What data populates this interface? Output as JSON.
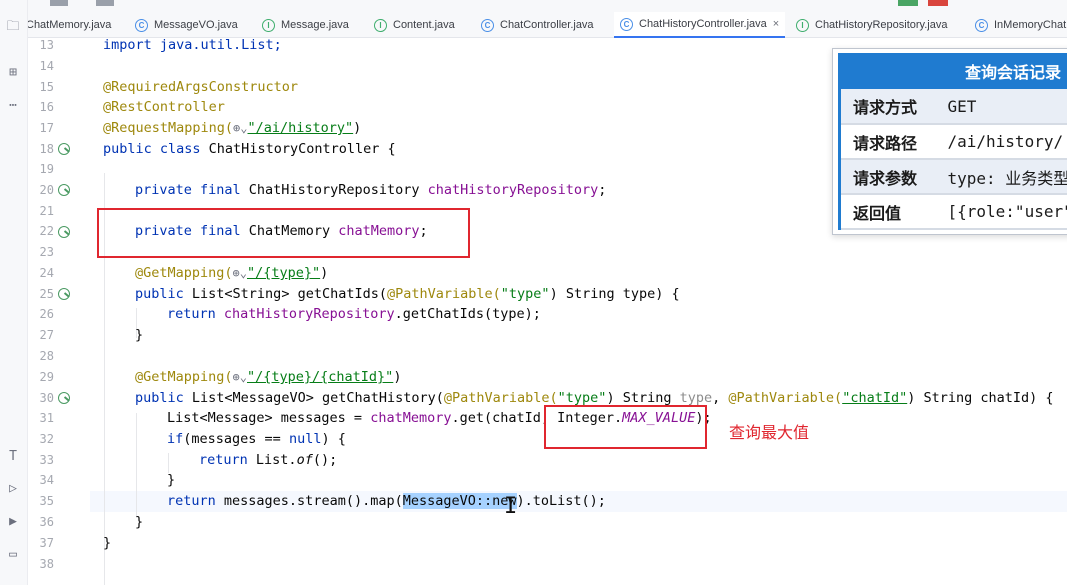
{
  "tabs": [
    {
      "label": "ChatMemory.java",
      "icon": "interface-icon",
      "active": false
    },
    {
      "label": "MessageVO.java",
      "icon": "class-icon",
      "active": false
    },
    {
      "label": "Message.java",
      "icon": "interface-icon",
      "active": false
    },
    {
      "label": "Content.java",
      "icon": "interface-icon",
      "active": false
    },
    {
      "label": "ChatController.java",
      "icon": "class-icon",
      "active": false
    },
    {
      "label": "ChatHistoryController.java",
      "icon": "class-icon",
      "active": true
    },
    {
      "label": "ChatHistoryRepository.java",
      "icon": "interface-icon",
      "active": false
    },
    {
      "label": "InMemoryChat",
      "icon": "class-icon",
      "active": false
    }
  ],
  "tab_close": "×",
  "line_numbers": [
    "13",
    "14",
    "15",
    "16",
    "17",
    "18",
    "19",
    "20",
    "21",
    "22",
    "23",
    "24",
    "25",
    "26",
    "27",
    "28",
    "29",
    "30",
    "31",
    "32",
    "33",
    "34",
    "35",
    "36",
    "37",
    "38"
  ],
  "code": {
    "l13": "import java.util.List;",
    "l15": "@RequiredArgsConstructor",
    "l16": "@RestController",
    "l17_ann": "@RequestMapping(",
    "l17_str": "\"/ai/history\"",
    "l17_end": ")",
    "l18_kw": "public class",
    "l18_rest": " ChatHistoryController {",
    "l20_kw": "private final",
    "l20_type": " ChatHistoryRepository ",
    "l20_fld": "chatHistoryRepository",
    "l20_end": ";",
    "l22_kw": "private final",
    "l22_type": " ChatMemory ",
    "l22_fld": "chatMemory",
    "l22_end": ";",
    "l24_ann": "@GetMapping(",
    "l24_str": "\"/{type}\"",
    "l24_end": ")",
    "l25_kw": "public",
    "l25_a": " List<String> getChatIds(",
    "l25_ann": "@PathVariable(",
    "l25_str": "\"type\"",
    "l25_b": ") String type) {",
    "l26_kw": "return",
    "l26_fld": " chatHistoryRepository",
    "l26_rest": ".getChatIds(type);",
    "l27": "}",
    "l29_ann": "@GetMapping(",
    "l29_str": "\"/{type}/{chatId}\"",
    "l29_end": ")",
    "l30_kw": "public",
    "l30_a": " List<MessageVO> getChatHistory(",
    "l30_ann1": "@PathVariable(",
    "l30_str1": "\"type\"",
    "l30_b": ") String ",
    "l30_gray": "type",
    "l30_c": ", ",
    "l30_ann2": "@PathVariable(",
    "l30_str2": "\"chatId\"",
    "l30_d": ") String chatId) {",
    "l31_a": "List<Message> messages = ",
    "l31_fld": "chatMemory",
    "l31_b": ".get(chatId, Integer.",
    "l31_const": "MAX_VALUE",
    "l31_c": ");",
    "l32_kw1": "if",
    "l32_a": "(messages == ",
    "l32_kw2": "null",
    "l32_b": ") {",
    "l33_kw": "return",
    "l33_a": " List.",
    "l33_of": "of",
    "l33_b": "();",
    "l34": "}",
    "l35_kw": "return",
    "l35_a": " messages.stream().map(",
    "l35_sel": "MessageVO::new",
    "l35_b": ").toList();",
    "l36": "}",
    "l37": "}"
  },
  "annotation_label": "查询最大值",
  "overlay": {
    "title": "查询会话记录",
    "rows": [
      {
        "key": "请求方式",
        "value": "GET"
      },
      {
        "key": "请求路径",
        "value": "/ai/history/"
      },
      {
        "key": "请求参数",
        "value": "type: 业务类型"
      },
      {
        "key": "返回值",
        "value": "[{role:\"user\""
      }
    ]
  },
  "colors": {
    "accent": "#3574f0",
    "annotation": "#e0262f",
    "overlay_header": "#1f7bd0"
  }
}
